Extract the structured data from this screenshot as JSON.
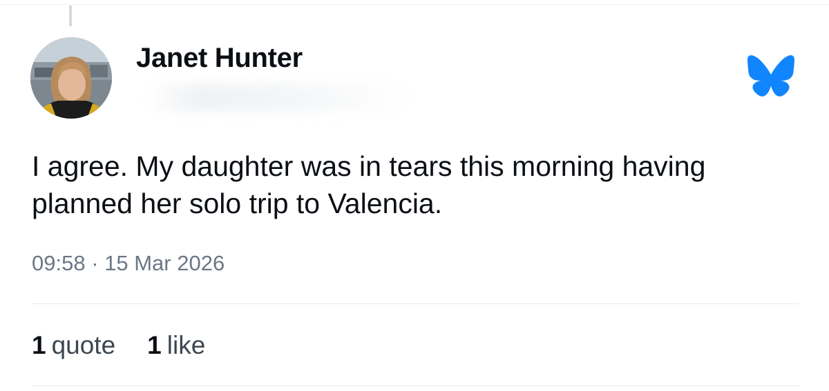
{
  "post": {
    "author_name": "Janet Hunter",
    "text": "I agree. My daughter was in tears this morning having planned her solo trip to Valencia.",
    "timestamp": "09:58 · 15 Mar 2026",
    "stats": {
      "quotes_count": "1",
      "quotes_label": "quote",
      "likes_count": "1",
      "likes_label": "like"
    }
  },
  "icons": {
    "brand": "bluesky-butterfly-icon"
  },
  "colors": {
    "brand_blue": "#1185fe",
    "text_primary": "#0b0f14",
    "text_secondary": "#6b7785",
    "divider": "#e6e9ec"
  }
}
